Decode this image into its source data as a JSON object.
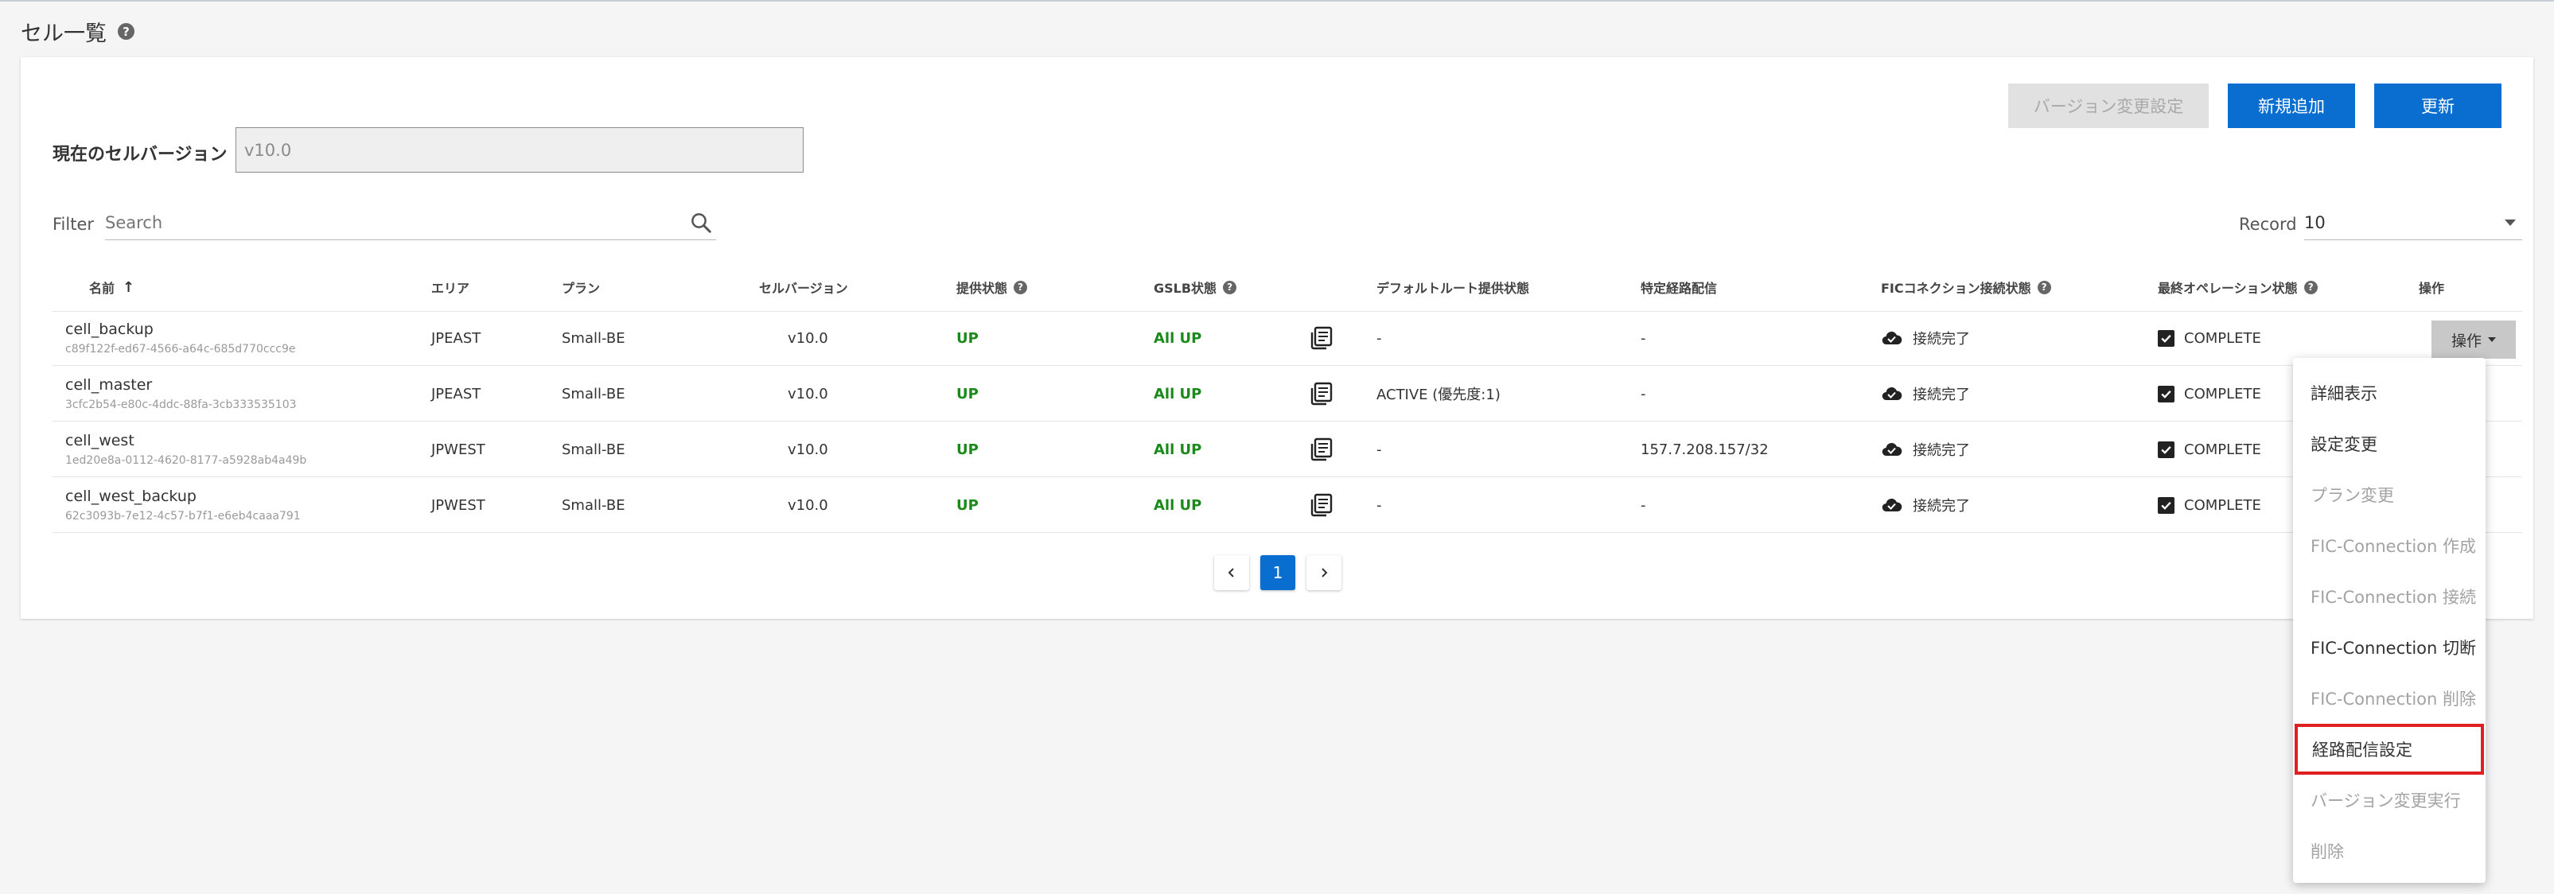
{
  "page": {
    "title": "セル一覧"
  },
  "toolbar": {
    "version_change_setting": "バージョン変更設定",
    "add_new": "新規追加",
    "refresh": "更新"
  },
  "current_version": {
    "label": "現在のセルバージョン",
    "value": "v10.0"
  },
  "filter": {
    "label": "Filter",
    "placeholder": "Search"
  },
  "record": {
    "label": "Record",
    "value": "10"
  },
  "table": {
    "headers": {
      "name": "名前",
      "area": "エリア",
      "plan": "プラン",
      "cell_version": "セルバージョン",
      "service_status": "提供状態",
      "gslb_status": "GSLB状態",
      "default_route": "デフォルトルート提供状態",
      "specific_route": "特定経路配信",
      "fic_status": "FICコネクション接続状態",
      "last_op_status": "最終オペレーション状態",
      "operation": "操作"
    },
    "rows": [
      {
        "name": "cell_backup",
        "id": "c89f122f-ed67-4566-a64c-685d770ccc9e",
        "area": "JPEAST",
        "plan": "Small-BE",
        "version": "v10.0",
        "service": "UP",
        "gslb": "All UP",
        "default_route": "-",
        "specific_route": "-",
        "fic": "接続完了",
        "last_op": "COMPLETE"
      },
      {
        "name": "cell_master",
        "id": "3cfc2b54-e80c-4ddc-88fa-3cb333535103",
        "area": "JPEAST",
        "plan": "Small-BE",
        "version": "v10.0",
        "service": "UP",
        "gslb": "All UP",
        "default_route": "ACTIVE (優先度:1)",
        "specific_route": "-",
        "fic": "接続完了",
        "last_op": "COMPLETE"
      },
      {
        "name": "cell_west",
        "id": "1ed20e8a-0112-4620-8177-a5928ab4a49b",
        "area": "JPWEST",
        "plan": "Small-BE",
        "version": "v10.0",
        "service": "UP",
        "gslb": "All UP",
        "default_route": "-",
        "specific_route": "157.7.208.157/32",
        "fic": "接続完了",
        "last_op": "COMPLETE"
      },
      {
        "name": "cell_west_backup",
        "id": "62c3093b-7e12-4c57-b7f1-e6eb4caaa791",
        "area": "JPWEST",
        "plan": "Small-BE",
        "version": "v10.0",
        "service": "UP",
        "gslb": "All UP",
        "default_route": "-",
        "specific_route": "-",
        "fic": "接続完了",
        "last_op": "COMPLETE"
      }
    ],
    "operation_button": "操作"
  },
  "pagination": {
    "current": "1"
  },
  "dropdown": {
    "items": [
      {
        "label": "詳細表示",
        "state": "enabled"
      },
      {
        "label": "設定変更",
        "state": "enabled"
      },
      {
        "label": "プラン変更",
        "state": "disabled"
      },
      {
        "label": "FIC-Connection 作成",
        "state": "disabled"
      },
      {
        "label": "FIC-Connection 接続",
        "state": "disabled"
      },
      {
        "label": "FIC-Connection 切断",
        "state": "enabled"
      },
      {
        "label": "FIC-Connection 削除",
        "state": "disabled"
      },
      {
        "label": "経路配信設定",
        "state": "highlighted"
      },
      {
        "label": "バージョン変更実行",
        "state": "disabled"
      },
      {
        "label": "削除",
        "state": "disabled"
      }
    ]
  },
  "colors": {
    "primary": "#0a6dd0",
    "status_up": "#1a8a1a",
    "highlight": "#e02020"
  }
}
